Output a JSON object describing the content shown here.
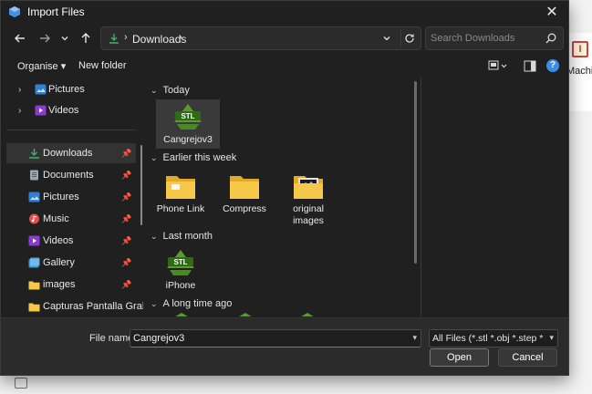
{
  "window": {
    "title": "Import Files",
    "close_glyph": "✕"
  },
  "background_app": {
    "toolbar_label": "Machin"
  },
  "navigation": {
    "back": "back-arrow-icon",
    "forward": "forward-arrow-icon",
    "recent": "chevron-down-icon",
    "up": "up-arrow-icon"
  },
  "address": {
    "path": "Downloads",
    "separator": "›"
  },
  "search": {
    "placeholder": "Search Downloads"
  },
  "commands": {
    "organise": "Organise ▾",
    "new_folder": "New folder"
  },
  "sidebar": {
    "items": [
      {
        "label": "Pictures",
        "icon": "pictures-icon",
        "expandable": true
      },
      {
        "label": "Videos",
        "icon": "videos-icon",
        "expandable": true
      },
      {
        "label": "Downloads",
        "icon": "downloads-icon",
        "pinned": true,
        "selected": true
      },
      {
        "label": "Documents",
        "icon": "documents-icon",
        "pinned": true
      },
      {
        "label": "Pictures",
        "icon": "pictures-icon",
        "pinned": true
      },
      {
        "label": "Music",
        "icon": "music-icon",
        "pinned": true
      },
      {
        "label": "Videos",
        "icon": "videos-icon",
        "pinned": true
      },
      {
        "label": "Gallery",
        "icon": "gallery-icon",
        "pinned": true
      },
      {
        "label": "images",
        "icon": "folder-icon",
        "pinned": true
      },
      {
        "label": "Capturas Pantalla Grabac",
        "icon": "folder-icon"
      }
    ]
  },
  "groups": [
    {
      "header": "Today",
      "files": [
        {
          "label": "Cangrejov3",
          "icon": "stl-file-icon",
          "selected": true
        }
      ]
    },
    {
      "header": "Earlier this week",
      "files": [
        {
          "label": "Phone Link",
          "icon": "folder-icon"
        },
        {
          "label": "Compress",
          "icon": "folder-icon"
        },
        {
          "label": "original images",
          "icon": "image-folder-icon"
        }
      ]
    },
    {
      "header": "Last month",
      "files": [
        {
          "label": "iPhone",
          "icon": "stl-file-icon"
        }
      ]
    },
    {
      "header": "A long time ago",
      "files": []
    }
  ],
  "stl_badge": "STL",
  "footer": {
    "file_name_label": "File name:",
    "file_name_value": "Cangrejov3",
    "filter": "All Files (*.stl *.obj *.step *.stp *",
    "open": "Open",
    "cancel": "Cancel"
  },
  "colors": {
    "accent": "#3a8ee6",
    "stl_green": "#5a9a2e",
    "folder_yellow": "#f5c84a",
    "download_green": "#3bb273"
  }
}
